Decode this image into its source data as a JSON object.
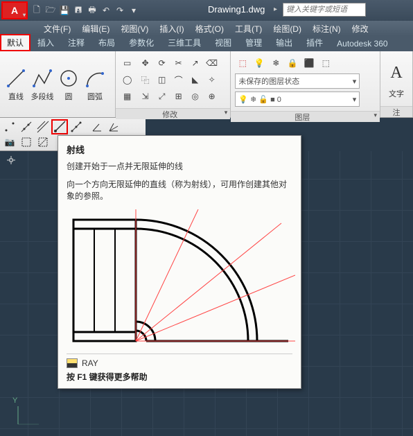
{
  "title": "Drawing1.dwg",
  "search_placeholder": "键入关键字或短语",
  "menus": [
    "文件(F)",
    "编辑(E)",
    "视图(V)",
    "插入(I)",
    "格式(O)",
    "工具(T)",
    "绘图(D)",
    "标注(N)",
    "修改"
  ],
  "ribbon_tabs": [
    "默认",
    "插入",
    "注释",
    "布局",
    "参数化",
    "三维工具",
    "视图",
    "管理",
    "输出",
    "插件",
    "Autodesk 360"
  ],
  "active_tab_index": 0,
  "draw_panel": {
    "buttons": [
      {
        "name": "line",
        "label": "直线"
      },
      {
        "name": "polyline",
        "label": "多段线"
      },
      {
        "name": "circle",
        "label": "圆"
      },
      {
        "name": "arc",
        "label": "圆弧"
      }
    ]
  },
  "modify_panel_title": "修改",
  "layers_panel_title": "图层",
  "annotation_panel_title": "注",
  "annotation_label": "文字",
  "layer_state": "未保存的图层状态",
  "tooltip": {
    "title": "射线",
    "subtitle": "创建开始于一点并无限延伸的线",
    "desc": "向一个方向无限延伸的直线（称为射线），可用作创建其他对象的参照。",
    "command": "RAY",
    "help": "按 F1 键获得更多帮助"
  },
  "origin_label": "Y"
}
